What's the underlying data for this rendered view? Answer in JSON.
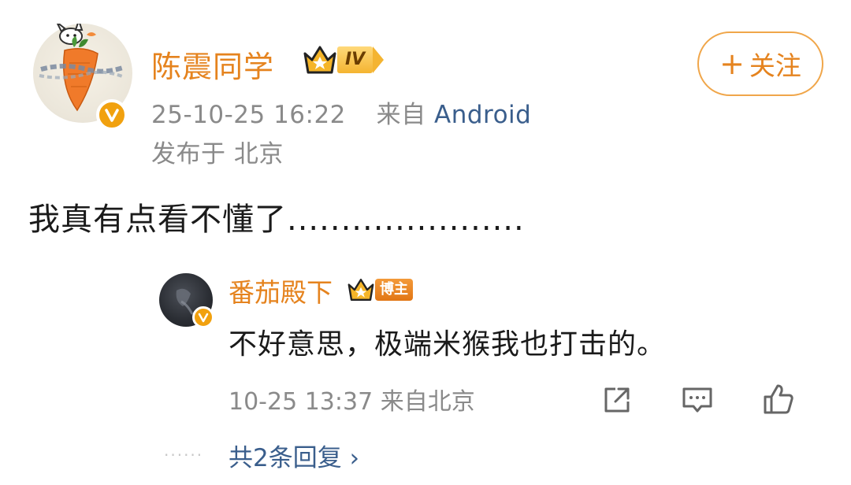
{
  "post": {
    "author": {
      "name": "陈震同学",
      "level_badge": "IV"
    },
    "timestamp": "25-10-25 16:22",
    "source_prefix": "来自",
    "device": "Android",
    "location": "发布于 北京",
    "follow_button": {
      "plus": "+",
      "label": "关注"
    },
    "text": "我真有点看不懂了......................"
  },
  "reply": {
    "author": {
      "name": "番茄殿下",
      "role_badge": "博主"
    },
    "text": "不好意思，极端米猴我也打击的。",
    "meta": "10-25 13:37 来自北京",
    "actions": [
      "share-icon",
      "comment-icon",
      "like-icon"
    ],
    "more_replies": "共2条回复 ›",
    "dots": "......"
  },
  "colors": {
    "username": "#e5831e",
    "link": "#3a5e8c",
    "meta": "#8a8a8a",
    "verified": "#f1a10f"
  }
}
